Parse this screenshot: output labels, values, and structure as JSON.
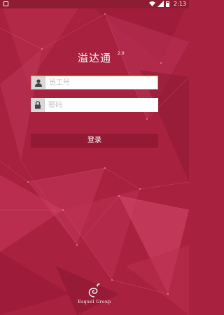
{
  "status_bar": {
    "time": "2:13"
  },
  "app": {
    "title": "溢达通",
    "version": "2.0"
  },
  "form": {
    "employee_id": {
      "placeholder": "员工号",
      "value": ""
    },
    "password": {
      "placeholder": "密码",
      "value": ""
    },
    "login_label": "登录"
  },
  "footer": {
    "brand": "Esquel Group"
  },
  "colors": {
    "background": "#a8213f",
    "input_focus_border": "#e9a426"
  }
}
